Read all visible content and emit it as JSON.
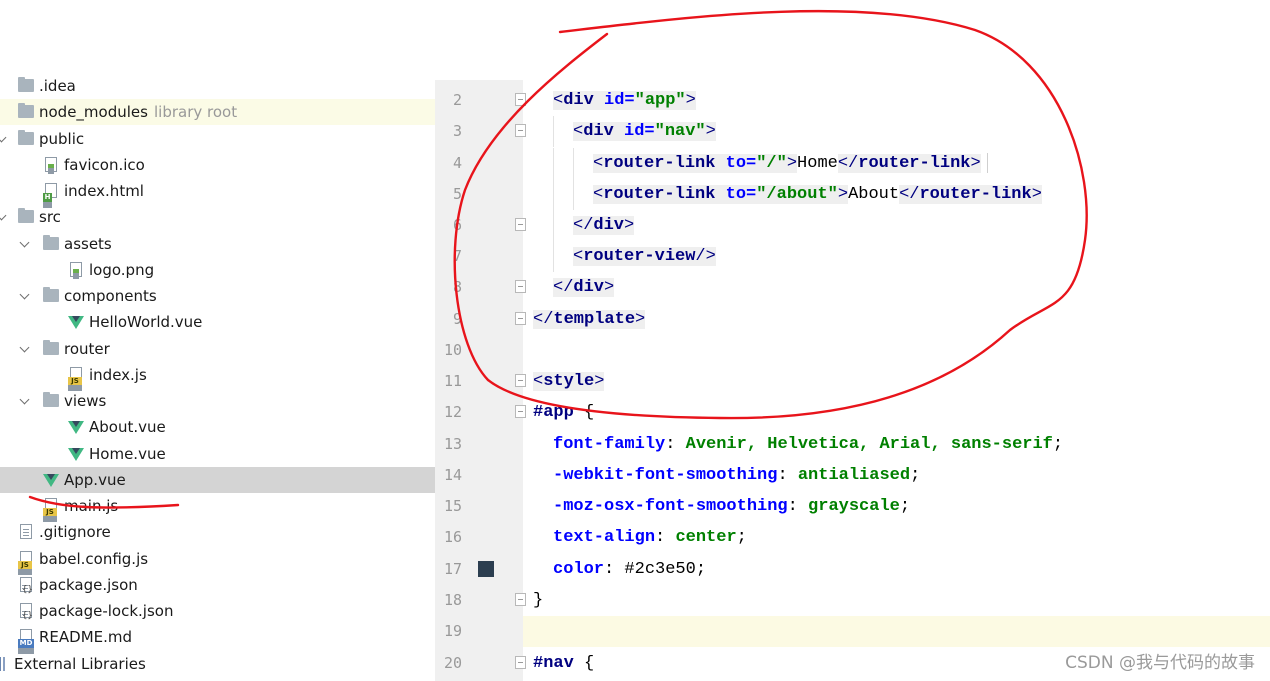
{
  "tree": [
    {
      "label": "idea_lbl",
      "text": ".idea"
    },
    {
      "text": "node_modules",
      "suffix": "library root"
    },
    {
      "text": "public"
    },
    {
      "text": "favicon.ico"
    },
    {
      "text": "index.html"
    },
    {
      "text": "src"
    },
    {
      "text": "assets"
    },
    {
      "text": "logo.png"
    },
    {
      "text": "components"
    },
    {
      "text": "HelloWorld.vue"
    },
    {
      "text": "router"
    },
    {
      "text": "index.js"
    },
    {
      "text": "views"
    },
    {
      "text": "About.vue"
    },
    {
      "text": "Home.vue"
    },
    {
      "text": "App.vue"
    },
    {
      "text": "main.js"
    },
    {
      "text": ".gitignore"
    },
    {
      "text": "babel.config.js"
    },
    {
      "text": "package.json"
    },
    {
      "text": "package-lock.json"
    },
    {
      "text": "README.md"
    },
    {
      "text": "External Libraries"
    }
  ],
  "editor": {
    "line_numbers": [
      "2",
      "3",
      "4",
      "5",
      "6",
      "7",
      "8",
      "9",
      "10",
      "11",
      "12",
      "13",
      "14",
      "15",
      "16",
      "17",
      "18",
      "19",
      "20"
    ],
    "html": {
      "lt": "<",
      "gt": ">",
      "lt_slash": "</",
      "self_close": "/>",
      "div": "div",
      "id_attr": "id=",
      "app_str": "\"app\"",
      "nav_str": "\"nav\"",
      "router_link": "router-link",
      "to_attr": "to=",
      "root_str": "\"/\"",
      "about_str": "\"/about\"",
      "home_text": "Home",
      "about_text": "About",
      "router_view": "router-view",
      "template": "template",
      "style": "style"
    },
    "css": {
      "app_selector": "#app",
      "nav_selector": "#nav",
      "open_brace": " {",
      "close_brace": "}",
      "decls": [
        {
          "prop": "font-family",
          "value": "Avenir, Helvetica, Arial, sans-serif"
        },
        {
          "prop": "-webkit-font-smoothing",
          "value": "antialiased"
        },
        {
          "prop": "-moz-osx-font-smoothing",
          "value": "grayscale"
        },
        {
          "prop": "text-align",
          "value": "center"
        },
        {
          "prop": "color",
          "value": "#2c3e50"
        }
      ],
      "color_swatch": "#2c3e50"
    }
  },
  "watermark": "CSDN @我与代码的故事",
  "annotation_color": "#e8141b"
}
